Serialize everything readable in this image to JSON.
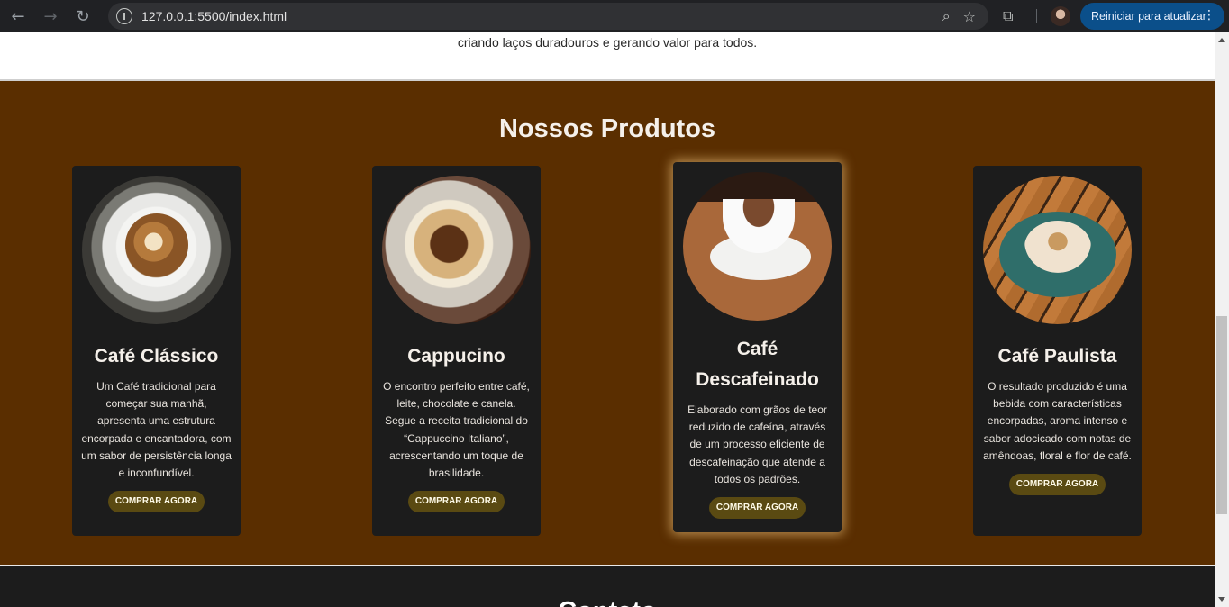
{
  "browser": {
    "url": "127.0.0.1:5500/index.html",
    "update_button": "Reiniciar para atualizar"
  },
  "about": {
    "text_line": "criando laços duradouros e gerando valor para todos."
  },
  "products": {
    "title": "Nossos Produtos",
    "items": [
      {
        "name": "Café Clássico",
        "description": "Um Café tradicional para começar sua manhã, apresenta uma estrutura encorpada e encantadora, com um sabor de persistência longa e inconfundível.",
        "button": "COMPRAR AGORA"
      },
      {
        "name": "Cappucino",
        "description": "O encontro perfeito entre café, leite, chocolate e canela. Segue a receita tradicional do “Cappuccino Italiano”, acrescentando um toque de brasilidade.",
        "button": "COMPRAR AGORA"
      },
      {
        "name": "Café Descafeinado",
        "description": "Elaborado com grãos de teor reduzido de cafeína, através de um processo eficiente de descafeinação que atende a todos os padrões.",
        "button": "COMPRAR AGORA"
      },
      {
        "name": "Café Paulista",
        "description": "O resultado produzido é uma bebida com características encorpadas, aroma intenso e sabor adocicado com notas de amêndoas, floral e flor de café.",
        "button": "COMPRAR AGORA"
      }
    ]
  },
  "next_section": {
    "title_partial": "Contato"
  }
}
